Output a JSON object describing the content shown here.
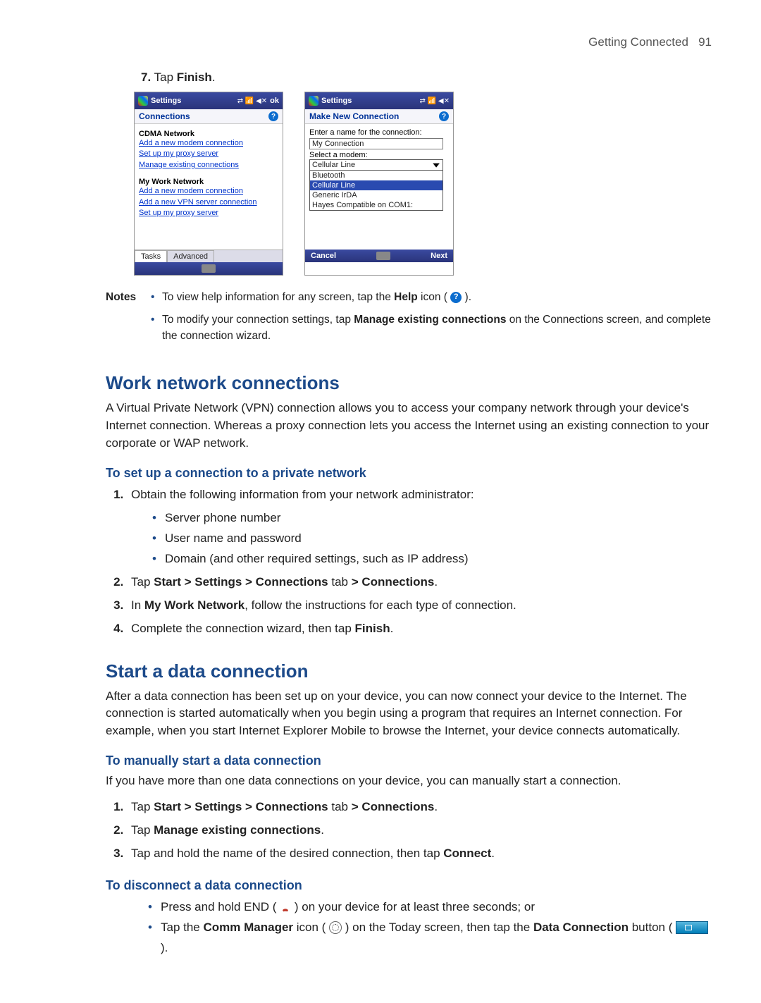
{
  "header": {
    "section": "Getting Connected",
    "page_number": "91"
  },
  "step7": {
    "number": "7.",
    "prefix": "Tap ",
    "bold": "Finish",
    "suffix": "."
  },
  "phone_left": {
    "title": "Settings",
    "ok": "ok",
    "subhead": "Connections",
    "cdma_title": "CDMA Network",
    "cdma_links": [
      "Add a new modem connection",
      "Set up my proxy server",
      "Manage existing connections"
    ],
    "work_title": "My Work Network",
    "work_links": [
      "Add a new modem connection",
      "Add a new VPN server connection",
      "Set up my proxy server"
    ],
    "tab1": "Tasks",
    "tab2": "Advanced"
  },
  "phone_right": {
    "title": "Settings",
    "subhead": "Make New Connection",
    "label_name": "Enter a name for the connection:",
    "value_name": "My Connection",
    "label_modem": "Select a modem:",
    "selected_modem": "Cellular Line",
    "options": [
      "Bluetooth",
      "Cellular Line",
      "Generic IrDA",
      "Hayes Compatible on COM1:"
    ],
    "cancel": "Cancel",
    "next": "Next"
  },
  "notes": {
    "label": "Notes",
    "n1a": "To view help information for any screen, tap the ",
    "n1b": "Help",
    "n1c": " icon ( ",
    "n1d": " ).",
    "n2a": "To modify your connection settings, tap ",
    "n2b": "Manage existing connections",
    "n2c": " on the Connections screen, and complete the connection wizard."
  },
  "h_work": "Work network connections",
  "p_work": "A Virtual Private Network (VPN) connection allows you to access your company network through your device's Internet connection. Whereas a proxy connection lets you access the Internet using an existing connection to your corporate or WAP network.",
  "h_setup": "To set up a connection to a private network",
  "step_s1": "Obtain the following information from your network administrator:",
  "s1_bullets": [
    "Server phone number",
    "User name and password",
    "Domain (and other required settings, such as IP address)"
  ],
  "step_s2": {
    "a": "Tap ",
    "b": "Start > Settings > Connections",
    "c": " tab ",
    "d": "> Connections",
    "e": "."
  },
  "step_s3": {
    "a": "In ",
    "b": "My Work Network",
    "c": ", follow the instructions for each type of connection."
  },
  "step_s4": {
    "a": "Complete the connection wizard, then tap ",
    "b": "Finish",
    "c": "."
  },
  "h_start": "Start a data connection",
  "p_start": "After a data connection has been set up on your device, you can now connect your device to the Internet. The connection is started automatically when you begin using a program that requires an Internet connection. For example, when you start Internet Explorer Mobile to browse the Internet, your device connects automatically.",
  "h_manual": "To manually start a data connection",
  "p_manual": "If you have more than one data connections on your device, you can manually start a connection.",
  "m1": {
    "a": "Tap ",
    "b": "Start > Settings > Connections",
    "c": " tab ",
    "d": "> Connections",
    "e": "."
  },
  "m2": {
    "a": "Tap ",
    "b": "Manage existing connections",
    "c": "."
  },
  "m3": {
    "a": "Tap and hold the name of the desired connection, then tap ",
    "b": "Connect",
    "c": "."
  },
  "h_disc": "To disconnect a data connection",
  "d1": {
    "a": "Press and hold END ( ",
    "b": " ) on your device for at least three seconds; or"
  },
  "d2": {
    "a": "Tap the ",
    "b": "Comm Manager",
    "c": " icon ( ",
    "d": " ) on the Today screen, then tap the ",
    "e": "Data Connection",
    "f": " button ( ",
    "g": " )."
  }
}
